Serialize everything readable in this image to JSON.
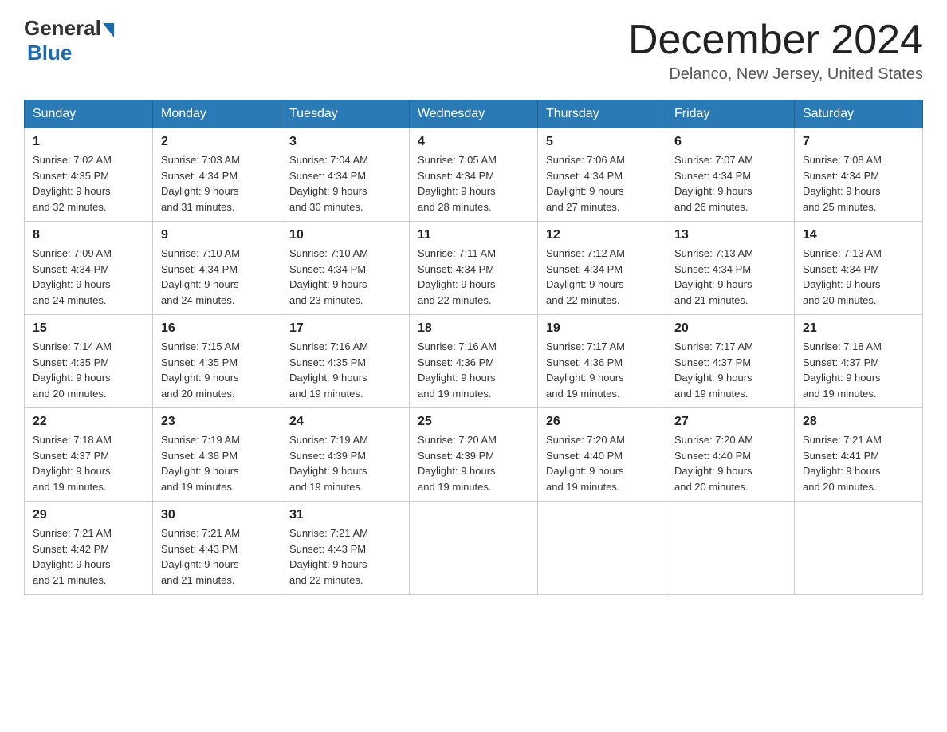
{
  "header": {
    "logo_general": "General",
    "logo_blue": "Blue",
    "title": "December 2024",
    "subtitle": "Delanco, New Jersey, United States"
  },
  "weekdays": [
    "Sunday",
    "Monday",
    "Tuesday",
    "Wednesday",
    "Thursday",
    "Friday",
    "Saturday"
  ],
  "weeks": [
    [
      {
        "day": "1",
        "sunrise": "7:02 AM",
        "sunset": "4:35 PM",
        "daylight": "9 hours and 32 minutes."
      },
      {
        "day": "2",
        "sunrise": "7:03 AM",
        "sunset": "4:34 PM",
        "daylight": "9 hours and 31 minutes."
      },
      {
        "day": "3",
        "sunrise": "7:04 AM",
        "sunset": "4:34 PM",
        "daylight": "9 hours and 30 minutes."
      },
      {
        "day": "4",
        "sunrise": "7:05 AM",
        "sunset": "4:34 PM",
        "daylight": "9 hours and 28 minutes."
      },
      {
        "day": "5",
        "sunrise": "7:06 AM",
        "sunset": "4:34 PM",
        "daylight": "9 hours and 27 minutes."
      },
      {
        "day": "6",
        "sunrise": "7:07 AM",
        "sunset": "4:34 PM",
        "daylight": "9 hours and 26 minutes."
      },
      {
        "day": "7",
        "sunrise": "7:08 AM",
        "sunset": "4:34 PM",
        "daylight": "9 hours and 25 minutes."
      }
    ],
    [
      {
        "day": "8",
        "sunrise": "7:09 AM",
        "sunset": "4:34 PM",
        "daylight": "9 hours and 24 minutes."
      },
      {
        "day": "9",
        "sunrise": "7:10 AM",
        "sunset": "4:34 PM",
        "daylight": "9 hours and 24 minutes."
      },
      {
        "day": "10",
        "sunrise": "7:10 AM",
        "sunset": "4:34 PM",
        "daylight": "9 hours and 23 minutes."
      },
      {
        "day": "11",
        "sunrise": "7:11 AM",
        "sunset": "4:34 PM",
        "daylight": "9 hours and 22 minutes."
      },
      {
        "day": "12",
        "sunrise": "7:12 AM",
        "sunset": "4:34 PM",
        "daylight": "9 hours and 22 minutes."
      },
      {
        "day": "13",
        "sunrise": "7:13 AM",
        "sunset": "4:34 PM",
        "daylight": "9 hours and 21 minutes."
      },
      {
        "day": "14",
        "sunrise": "7:13 AM",
        "sunset": "4:34 PM",
        "daylight": "9 hours and 20 minutes."
      }
    ],
    [
      {
        "day": "15",
        "sunrise": "7:14 AM",
        "sunset": "4:35 PM",
        "daylight": "9 hours and 20 minutes."
      },
      {
        "day": "16",
        "sunrise": "7:15 AM",
        "sunset": "4:35 PM",
        "daylight": "9 hours and 20 minutes."
      },
      {
        "day": "17",
        "sunrise": "7:16 AM",
        "sunset": "4:35 PM",
        "daylight": "9 hours and 19 minutes."
      },
      {
        "day": "18",
        "sunrise": "7:16 AM",
        "sunset": "4:36 PM",
        "daylight": "9 hours and 19 minutes."
      },
      {
        "day": "19",
        "sunrise": "7:17 AM",
        "sunset": "4:36 PM",
        "daylight": "9 hours and 19 minutes."
      },
      {
        "day": "20",
        "sunrise": "7:17 AM",
        "sunset": "4:37 PM",
        "daylight": "9 hours and 19 minutes."
      },
      {
        "day": "21",
        "sunrise": "7:18 AM",
        "sunset": "4:37 PM",
        "daylight": "9 hours and 19 minutes."
      }
    ],
    [
      {
        "day": "22",
        "sunrise": "7:18 AM",
        "sunset": "4:37 PM",
        "daylight": "9 hours and 19 minutes."
      },
      {
        "day": "23",
        "sunrise": "7:19 AM",
        "sunset": "4:38 PM",
        "daylight": "9 hours and 19 minutes."
      },
      {
        "day": "24",
        "sunrise": "7:19 AM",
        "sunset": "4:39 PM",
        "daylight": "9 hours and 19 minutes."
      },
      {
        "day": "25",
        "sunrise": "7:20 AM",
        "sunset": "4:39 PM",
        "daylight": "9 hours and 19 minutes."
      },
      {
        "day": "26",
        "sunrise": "7:20 AM",
        "sunset": "4:40 PM",
        "daylight": "9 hours and 19 minutes."
      },
      {
        "day": "27",
        "sunrise": "7:20 AM",
        "sunset": "4:40 PM",
        "daylight": "9 hours and 20 minutes."
      },
      {
        "day": "28",
        "sunrise": "7:21 AM",
        "sunset": "4:41 PM",
        "daylight": "9 hours and 20 minutes."
      }
    ],
    [
      {
        "day": "29",
        "sunrise": "7:21 AM",
        "sunset": "4:42 PM",
        "daylight": "9 hours and 21 minutes."
      },
      {
        "day": "30",
        "sunrise": "7:21 AM",
        "sunset": "4:43 PM",
        "daylight": "9 hours and 21 minutes."
      },
      {
        "day": "31",
        "sunrise": "7:21 AM",
        "sunset": "4:43 PM",
        "daylight": "9 hours and 22 minutes."
      },
      null,
      null,
      null,
      null
    ]
  ],
  "labels": {
    "sunrise_prefix": "Sunrise: ",
    "sunset_prefix": "Sunset: ",
    "daylight_prefix": "Daylight: "
  }
}
